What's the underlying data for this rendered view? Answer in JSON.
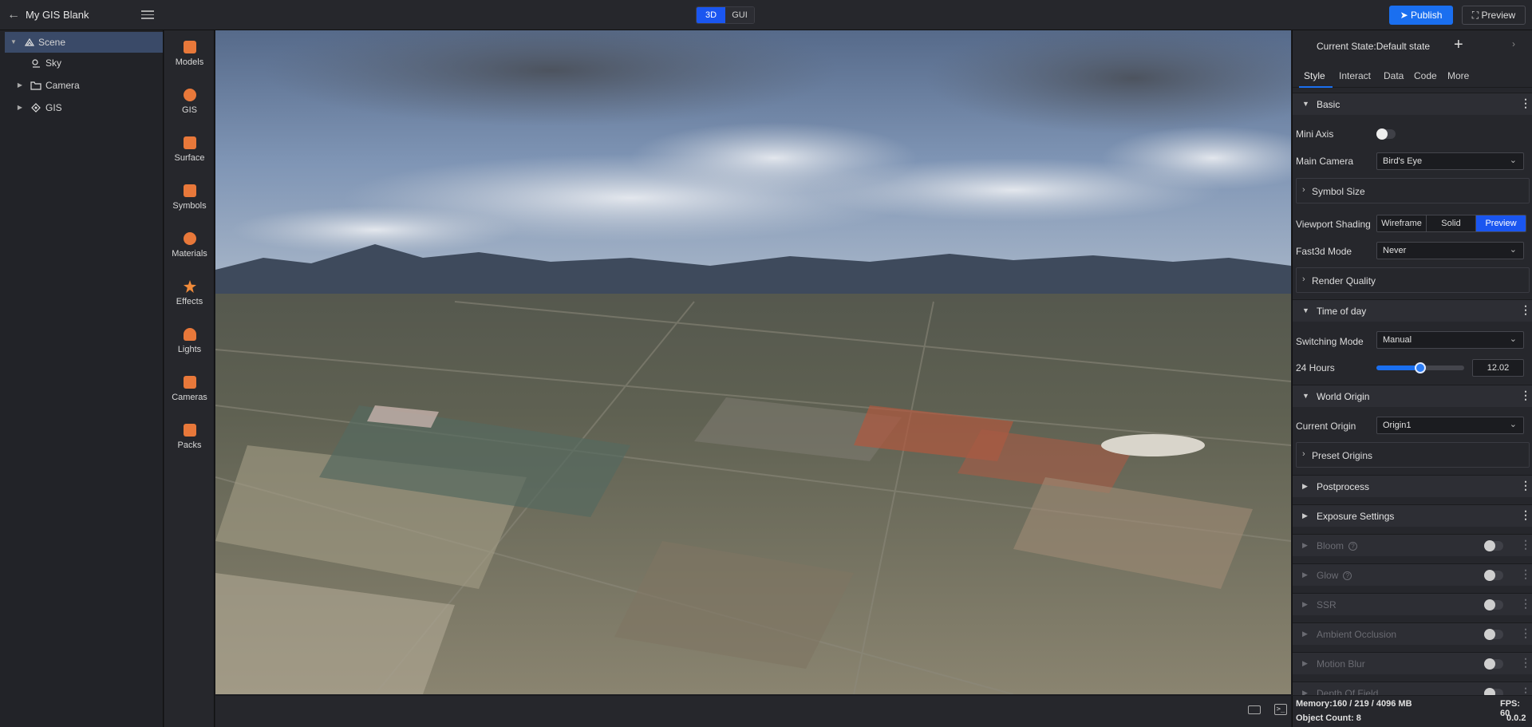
{
  "header": {
    "app_title": "My GIS Blank",
    "mode_3d": "3D",
    "mode_gui": "GUI",
    "publish_label": "Publish",
    "preview_label": "Preview",
    "accent": "#1a6ff0"
  },
  "tree": {
    "items": [
      {
        "label": "Scene",
        "icon": "scene-icon"
      },
      {
        "label": "Sky",
        "icon": "sky-icon"
      },
      {
        "label": "Camera",
        "icon": "folder-icon"
      },
      {
        "label": "GIS",
        "icon": "gis-icon"
      }
    ]
  },
  "toolbar": {
    "items": [
      {
        "label": "Models",
        "icon": "models-icon"
      },
      {
        "label": "GIS",
        "icon": "gis-icon"
      },
      {
        "label": "Surface",
        "icon": "surface-icon"
      },
      {
        "label": "Symbols",
        "icon": "symbols-icon"
      },
      {
        "label": "Materials",
        "icon": "materials-icon"
      },
      {
        "label": "Effects",
        "icon": "effects-icon"
      },
      {
        "label": "Lights",
        "icon": "lights-icon"
      },
      {
        "label": "Cameras",
        "icon": "cameras-icon"
      },
      {
        "label": "Packs",
        "icon": "packs-icon"
      }
    ]
  },
  "panel": {
    "state_title": "Current State:Default state",
    "tabs": [
      "Style",
      "Interact",
      "Data",
      "Code",
      "More"
    ],
    "basic": {
      "title": "Basic",
      "mini_axis_label": "Mini Axis",
      "main_camera_label": "Main Camera",
      "main_camera_value": "Bird's Eye",
      "symbol_size_label": "Symbol Size",
      "viewport_shading_label": "Viewport Shading",
      "shading_options": [
        "Wireframe",
        "Solid",
        "Preview"
      ],
      "shading_selected": "Preview",
      "fast3d_label": "Fast3d Mode",
      "fast3d_value": "Never",
      "render_quality_label": "Render Quality"
    },
    "time_of_day": {
      "title": "Time of day",
      "switching_mode_label": "Switching Mode",
      "switching_mode_value": "Manual",
      "hours_label": "24 Hours",
      "hours_value": "12.02",
      "slider_fraction": 0.5
    },
    "world_origin": {
      "title": "World Origin",
      "current_origin_label": "Current Origin",
      "current_origin_value": "Origin1",
      "preset_origins_label": "Preset Origins"
    },
    "postprocess_title": "Postprocess",
    "exposure_title": "Exposure Settings",
    "effects": [
      "Bloom",
      "Glow",
      "SSR",
      "Ambient Occlusion",
      "Motion Blur",
      "Depth Of Field"
    ]
  },
  "status": {
    "memory": "Memory:160 / 219 / 4096 MB",
    "fps": "FPS: 60",
    "object_count": "Object Count: 8",
    "version": "0.0.2"
  }
}
